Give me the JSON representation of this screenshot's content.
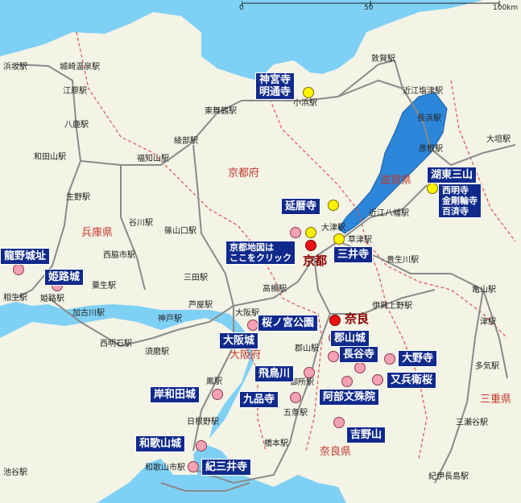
{
  "scale": {
    "ticks": [
      "0",
      "50",
      "100km"
    ]
  },
  "prefectures": [
    "京都府",
    "兵庫県",
    "大阪府",
    "奈良県",
    "滋賀県",
    "三重県"
  ],
  "cities": [
    "京都",
    "奈良"
  ],
  "stations": [
    "浜坂駅",
    "城崎温泉駅",
    "江原駅",
    "八鹿駅",
    "和田山駅",
    "生野駅",
    "谷川駅",
    "福知山駅",
    "綾部駅",
    "東舞鶴駅",
    "小浜駅",
    "敦賀駅",
    "近江塩津駅",
    "長浜駅",
    "彦根駅",
    "大垣駅",
    "近江八幡駅",
    "大津駅",
    "草津駅",
    "貴生川駅",
    "亀山駅",
    "津駅",
    "多気駅",
    "伊賀上野駅",
    "篠山口駅",
    "三田駅",
    "西脇市駅",
    "粟生駅",
    "加古川駅",
    "相生駅",
    "姫路駅",
    "西明石駅",
    "神戸駅",
    "芦屋駅",
    "大阪駅",
    "須磨駅",
    "高槻駅",
    "郡山駅",
    "御所駅",
    "五条駅",
    "橋本駅",
    "日根野駅",
    "和歌山市駅",
    "鳳駅",
    "池谷駅",
    "三瀬谷駅",
    "紀伊長島駅"
  ],
  "poi_labels": {
    "jingu_myotsuji": [
      "神宮寺",
      "明通寺"
    ],
    "enryakuji": "延暦寺",
    "kyoto_map_link": [
      "京都地図は",
      "ここをクリック"
    ],
    "miidera": "三井寺",
    "kotou_sanzan_title": "湖東三山",
    "kotou_sanzan_temples": [
      "西明寺",
      "金剛輪寺",
      "百済寺"
    ],
    "tatsuno": "龍野城址",
    "himeji": "姫路城",
    "sakuranomiya": "桜ノ宮公園",
    "osakajo": "大阪城",
    "koriyama": "郡山城",
    "hasedera": "長谷寺",
    "onodera": "大野寺",
    "asukagawa": "飛鳥川",
    "matabe": "又兵衛桜",
    "abe_monju": "阿部文殊院",
    "kishiwada": "岸和田城",
    "kuhonji": "九品寺",
    "yoshino": "吉野山",
    "wakayama": "和歌山城",
    "kimiidera": "紀三井寺"
  },
  "colors": {
    "sea": "#7fd0f5",
    "land": "#f3f3e6",
    "lake": "#2c86d9",
    "rail": "#8a8a8a",
    "border": "#e05050",
    "label_bg": "#102a8c"
  }
}
